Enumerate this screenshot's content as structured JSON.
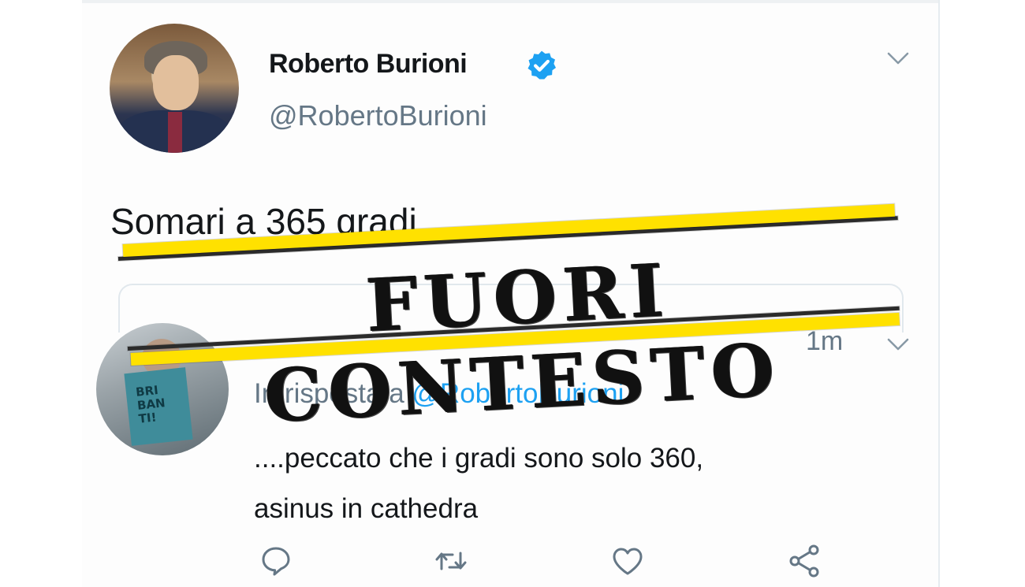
{
  "tweet": {
    "author_name": "Roberto Burioni",
    "author_handle": "@RobertoBurioni",
    "text": "Somari a 365 gradi"
  },
  "reply": {
    "time": "1m",
    "in_reply_prefix": "In risposta a ",
    "in_reply_mention": "@RobertoBurioni",
    "text_line1": "....peccato che i gradi sono solo 360,",
    "text_line2": "asinus in cathedra",
    "avatar_book_text": "BRI BAN TI!"
  },
  "stamp": {
    "label": "FUORI CONTESTO",
    "color": "#ffe100"
  },
  "icons": {
    "verified": "verified-badge-icon",
    "chevron": "chevron-down-icon",
    "reply": "reply-icon",
    "retweet": "retweet-icon",
    "like": "heart-icon",
    "share": "share-icon"
  },
  "colors": {
    "link": "#1da1f2",
    "secondary_text": "#657786",
    "primary_text": "#14171a"
  }
}
